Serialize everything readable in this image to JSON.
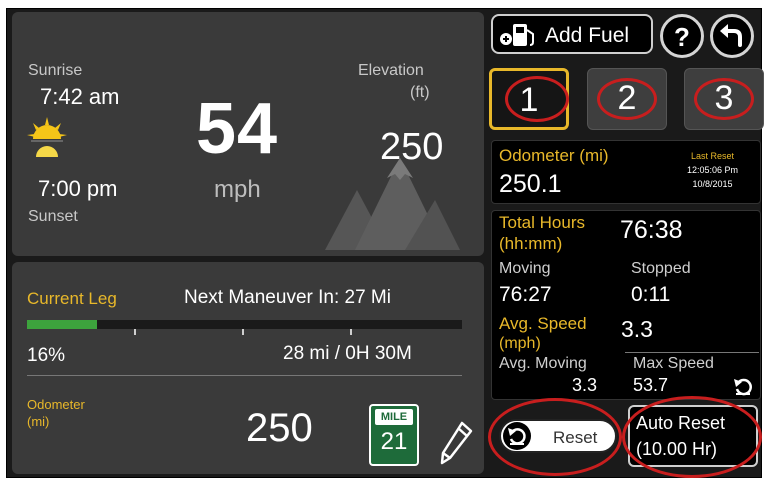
{
  "weather": {
    "sunrise_label": "Sunrise",
    "sunrise_time": "7:42 am",
    "sunset_time": "7:00 pm",
    "sunset_label": "Sunset"
  },
  "speed": {
    "value": "54",
    "unit": "mph"
  },
  "elevation": {
    "label": "Elevation",
    "unit": "(ft)",
    "value": "250"
  },
  "leg": {
    "label": "Current Leg",
    "next_maneuver": "Next Maneuver In: 27 Mi",
    "progress_percent": 16,
    "percent_text": "16%",
    "remaining": "28 mi / 0H 30M"
  },
  "bottom_odometer": {
    "label": "Odometer",
    "unit": "(mi)",
    "value": "250",
    "mile_sign_top": "MILE",
    "mile_sign_number": "21"
  },
  "toolbar": {
    "add_fuel_label": "Add Fuel",
    "help_label": "?"
  },
  "trips": [
    {
      "label": "1",
      "selected": true
    },
    {
      "label": "2",
      "selected": false
    },
    {
      "label": "3",
      "selected": false
    }
  ],
  "trip_odometer": {
    "label": "Odometer (mi)",
    "value": "250.1",
    "last_reset_label": "Last Reset",
    "last_reset_time": "12:05:06 Pm",
    "last_reset_date": "10/8/2015"
  },
  "trip_stats": {
    "total_hours_label": "Total Hours",
    "total_hours_unit": "(hh:mm)",
    "total_hours_value": "76:38",
    "moving_label": "Moving",
    "moving_value": "76:27",
    "stopped_label": "Stopped",
    "stopped_value": "0:11",
    "avg_speed_label": "Avg. Speed",
    "avg_speed_unit": "(mph)",
    "avg_speed_value": "3.3",
    "avg_moving_label": "Avg. Moving",
    "avg_moving_value": "3.3",
    "max_speed_label": "Max Speed",
    "max_speed_value": "53.7"
  },
  "actions": {
    "reset_label": "Reset",
    "auto_reset_line1": "Auto Reset",
    "auto_reset_line2": "(10.00 Hr)"
  },
  "colors": {
    "accent_gold": "#e8b82a",
    "progress_green": "#3da33d",
    "highlight_red": "#c81e1e",
    "panel_bg": "#3a3a3a"
  }
}
